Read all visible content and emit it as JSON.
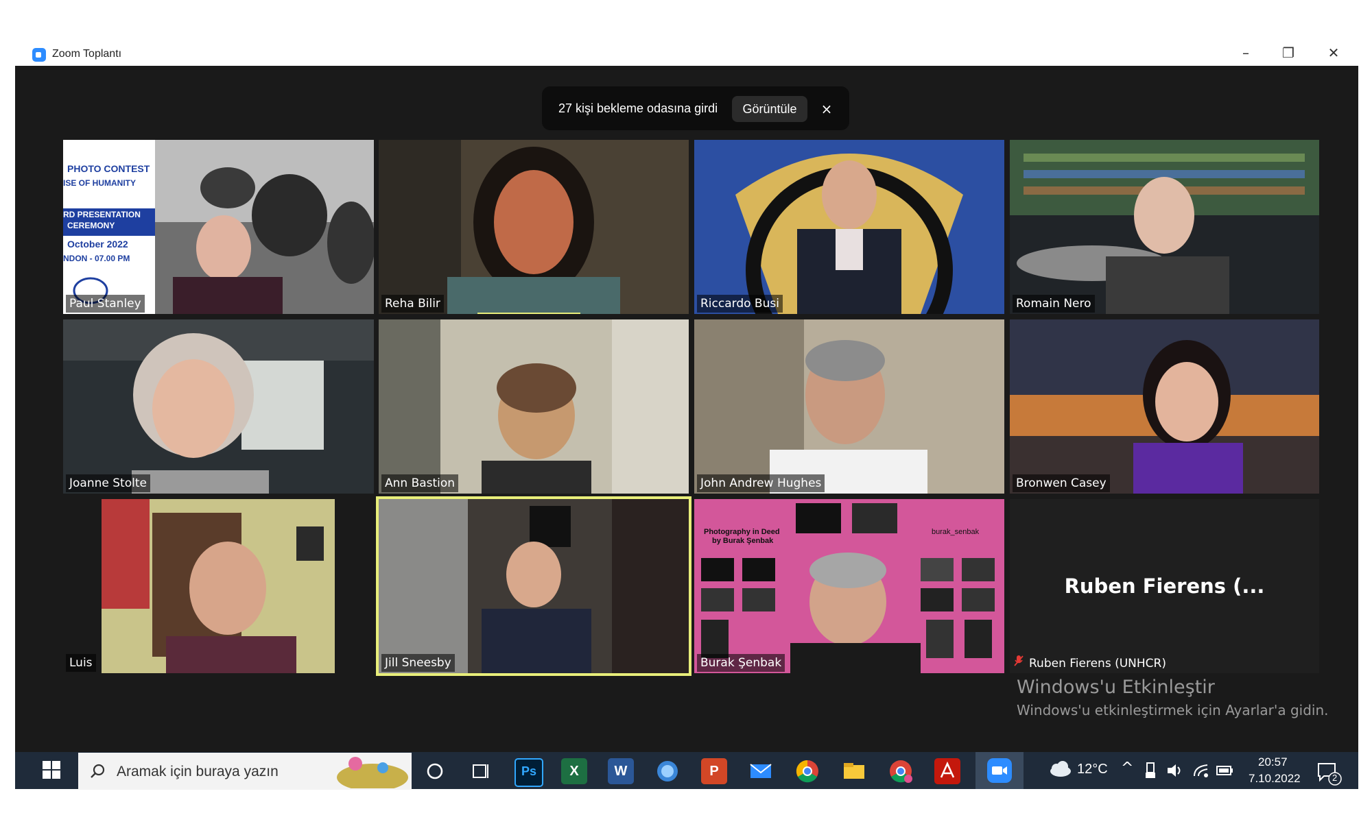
{
  "window": {
    "title": "Zoom Toplantı"
  },
  "notification": {
    "text": "27 kişi bekleme odasına girdi",
    "button_label": "Görüntüle",
    "close_glyph": "×"
  },
  "participants": [
    {
      "name": "Paul Stanley",
      "slide_lines": [
        "PHOTO CONTEST",
        "ISE OF HUMANITY",
        "RD PRESENTATION",
        "CEREMONY",
        "October 2022",
        "NDON - 07.00 PM"
      ]
    },
    {
      "name": "Reha Bilir"
    },
    {
      "name": "Riccardo Busi"
    },
    {
      "name": "Romain Nero"
    },
    {
      "name": "Joanne Stolte"
    },
    {
      "name": "Ann Bastion"
    },
    {
      "name": "John Andrew Hughes"
    },
    {
      "name": "Bronwen Casey"
    },
    {
      "name": "Luis"
    },
    {
      "name": "Jill Sneesby"
    },
    {
      "name": "Burak Şenbak",
      "bg_lines": [
        "Photography in Deed",
        "by Burak Şenbak",
        "burak_senbak"
      ]
    },
    {
      "name": "Ruben Fierens (UNHCR)",
      "display_name": "Ruben Fierens (..."
    }
  ],
  "watermark": {
    "line1": "Windows'u Etkinleştir",
    "line2": "Windows'u etkinleştirmek için Ayarlar'a gidin."
  },
  "taskbar": {
    "search_placeholder": "Aramak için buraya yazın",
    "weather": "12°C",
    "time": "20:57",
    "date": "7.10.2022",
    "notification_count": "2",
    "apps": [
      "task-view",
      "photoshop",
      "excel",
      "word",
      "app-globe",
      "powerpoint",
      "mail",
      "chrome",
      "file-explorer",
      "chrome-profile",
      "adobe-acrobat",
      "zoom"
    ]
  },
  "colors": {
    "meeting_bg": "#1a1a1a",
    "active_speaker": "#e8ee7a",
    "taskbar": "#1f2b3a",
    "zoom_blue": "#2d8cff"
  }
}
